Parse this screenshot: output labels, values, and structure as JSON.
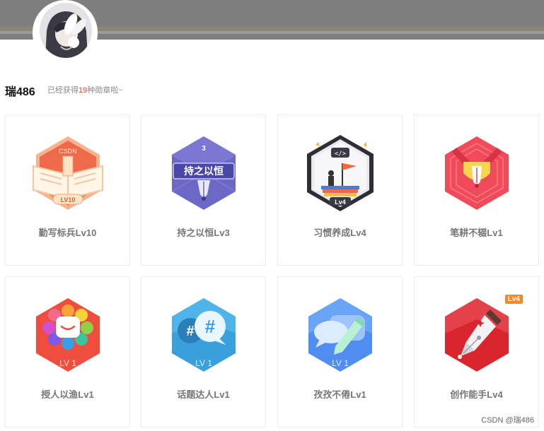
{
  "user": {
    "name": "瑞486"
  },
  "summary": {
    "prefix": "已经获得",
    "count": "19",
    "suffix": "种勋章啦~"
  },
  "badges": [
    {
      "name": "勤写标兵Lv10",
      "icon": "book-badge-icon",
      "color": "#ef6a4a",
      "inner_text": "LV10",
      "top_text": "CSDN"
    },
    {
      "name": "持之以恒Lv3",
      "icon": "pen-badge-icon",
      "color": "#5a57b5",
      "inner_text": "持之以恒",
      "top_text": "3"
    },
    {
      "name": "习惯养成Lv4",
      "icon": "flag-badge-icon",
      "color": "#3a3a44",
      "inner_text": "Lv4"
    },
    {
      "name": "笔耕不辍Lv1",
      "icon": "nib-badge-icon",
      "color": "#f04b5a"
    },
    {
      "name": "授人以渔Lv1",
      "icon": "flower-badge-icon",
      "color": "#ef4d3d",
      "inner_text": "LV 1"
    },
    {
      "name": "话题达人Lv1",
      "icon": "hashtag-badge-icon",
      "color": "#3aa0dc",
      "inner_text": "LV 1"
    },
    {
      "name": "孜孜不倦Lv1",
      "icon": "chat-pencil-badge-icon",
      "color": "#4f8df0",
      "inner_text": "LV 1"
    },
    {
      "name": "创作能手Lv4",
      "icon": "fountain-pen-badge-icon",
      "color": "#d9262e",
      "tag": "Lv4"
    }
  ],
  "watermark": "CSDN @瑞486"
}
